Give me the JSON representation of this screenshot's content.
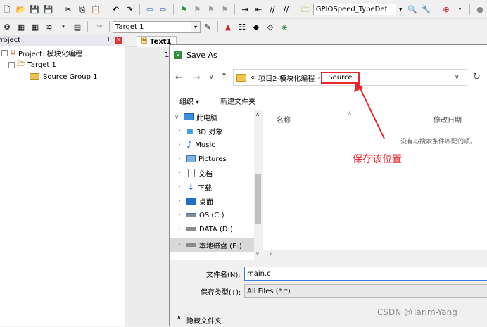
{
  "toolbar": {
    "device_combo": "GPIOSpeed_TypeDef",
    "target_combo": "Target 1",
    "load_label": "Load"
  },
  "project_panel": {
    "title": "Project",
    "tree": [
      {
        "label": "Project: 模块化编程"
      },
      {
        "label": "Target 1"
      },
      {
        "label": "Source Group 1"
      }
    ]
  },
  "editor": {
    "tab_label": "Text1",
    "line_number": "1"
  },
  "dialog": {
    "title": "Save As",
    "breadcrumb_prefix": "«",
    "breadcrumb_parent": "项目2-模块化编程",
    "breadcrumb_current": "Source",
    "organize_label": "组织 ▾",
    "new_folder_label": "新建文件夹",
    "nav_items": [
      {
        "label": "此电脑",
        "icon": "computer-icon"
      },
      {
        "label": "3D 对象",
        "icon": "cube-icon"
      },
      {
        "label": "Music",
        "icon": "music-icon"
      },
      {
        "label": "Pictures",
        "icon": "picture-icon"
      },
      {
        "label": "文档",
        "icon": "document-icon"
      },
      {
        "label": "下载",
        "icon": "download-icon"
      },
      {
        "label": "桌面",
        "icon": "desktop-icon"
      },
      {
        "label": "OS (C:)",
        "icon": "drive-icon"
      },
      {
        "label": "DATA (D:)",
        "icon": "drive-icon"
      },
      {
        "label": "本地磁盘 (E:)",
        "icon": "drive-icon"
      }
    ],
    "col_name": "名称",
    "col_date": "修改日期",
    "empty_message": "没有与搜索条件匹配的项。",
    "filename_label": "文件名(N):",
    "filename_value": "main.c",
    "filetype_label": "保存类型(T):",
    "filetype_value": "All Files (*.*)",
    "hide_folders_label": "隐藏文件夹"
  },
  "annotation": {
    "text": "保存该位置",
    "color": "#e8262b"
  },
  "watermark": "CSDN @Tarim-Yang"
}
